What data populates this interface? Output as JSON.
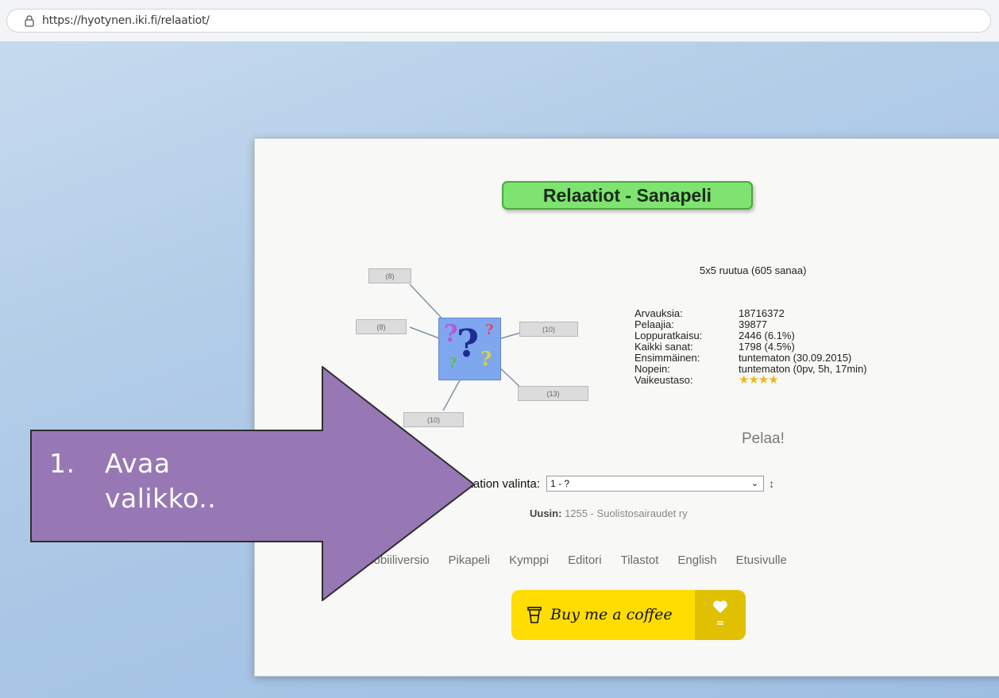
{
  "browser": {
    "url": "https://hyotynen.iki.fi/relaatiot/"
  },
  "game": {
    "title": "Relaatiot - Sanapeli",
    "grid_info": "5x5 ruutua (605 sanaa)",
    "nodes": [
      "(8)",
      "(8)",
      "(10)",
      "(13)",
      "(10)"
    ],
    "stats": [
      {
        "key": "Arvauksia:",
        "value": "18716372"
      },
      {
        "key": "Pelaajia:",
        "value": "39877"
      },
      {
        "key": "Loppuratkaisu:",
        "value": "2446 (6.1%)"
      },
      {
        "key": "Kaikki sanat:",
        "value": "1798 (4.5%)"
      },
      {
        "key": "Ensimmäinen:",
        "value": "tuntematon (30.09.2015)"
      },
      {
        "key": "Nopein:",
        "value": "tuntematon (0pv, 5h, 17min)"
      },
      {
        "key": "Vaikeustaso:",
        "value": "★★★★"
      }
    ],
    "play_label": "Pelaa!",
    "select_label": "Relaation valinta:",
    "select_value": "1 - ?",
    "newest_label": "Uusin:",
    "newest_value": " 1255 - Suolistosairaudet ry",
    "nav_links": [
      "Mobiiliversio",
      "Pikapeli",
      "Kymppi",
      "Editori",
      "Tilastot",
      "English",
      "Etusivulle"
    ],
    "coffee_label": "Buy me a coffee"
  },
  "callout": {
    "number": "1.",
    "line1": "Avaa",
    "line2": "valikko.."
  },
  "colors": {
    "title_bg": "#7ee36f",
    "qbox": "#7fa7ef",
    "arrow": "#9778b4",
    "coffee": "#ffdd00"
  }
}
